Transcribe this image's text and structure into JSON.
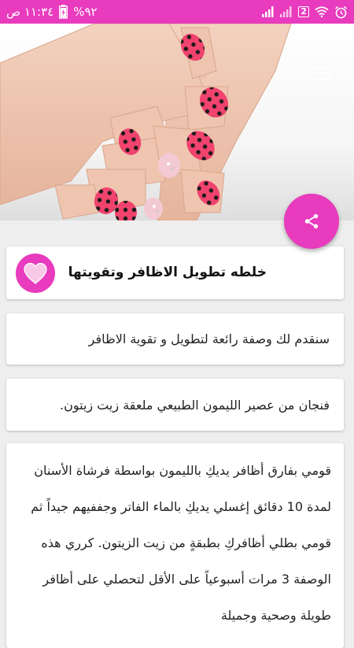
{
  "status_bar": {
    "time": "١١:٣٤ ص",
    "battery": "%٩٢",
    "sim_slot": "2"
  },
  "recipe": {
    "title": "خلطه تطويل الاظافر وتقويتها",
    "intro": "سنقدم لك وصفة رائعة لتطويل و تقوية الاظافر",
    "ingredients": "فنجان من عصير الليمون الطبيعي ملعقة زيت زيتون.",
    "method": "قومي بفارق أظافر يديكِ بالليمون بواسطة فرشاة الأسنان لمدة 10 دقائق إغسلي يديكِ بالماء الفاتر وجففيهم جيداً ثم قومي بطلي أظافركِ بطبقةٍ من زيت الزيتون. كرري هذه الوصفة 3 مرات أسبوعياً على الأقل لتحصلي على أظافر طويلة وصحية وجميلة"
  },
  "icons": {
    "menu": "hamburger-menu-icon",
    "share": "share-icon",
    "favorite": "heart-icon"
  },
  "colors": {
    "accent": "#e83bbd",
    "nail_polish": "#f0436e",
    "background": "#eeeeee"
  }
}
